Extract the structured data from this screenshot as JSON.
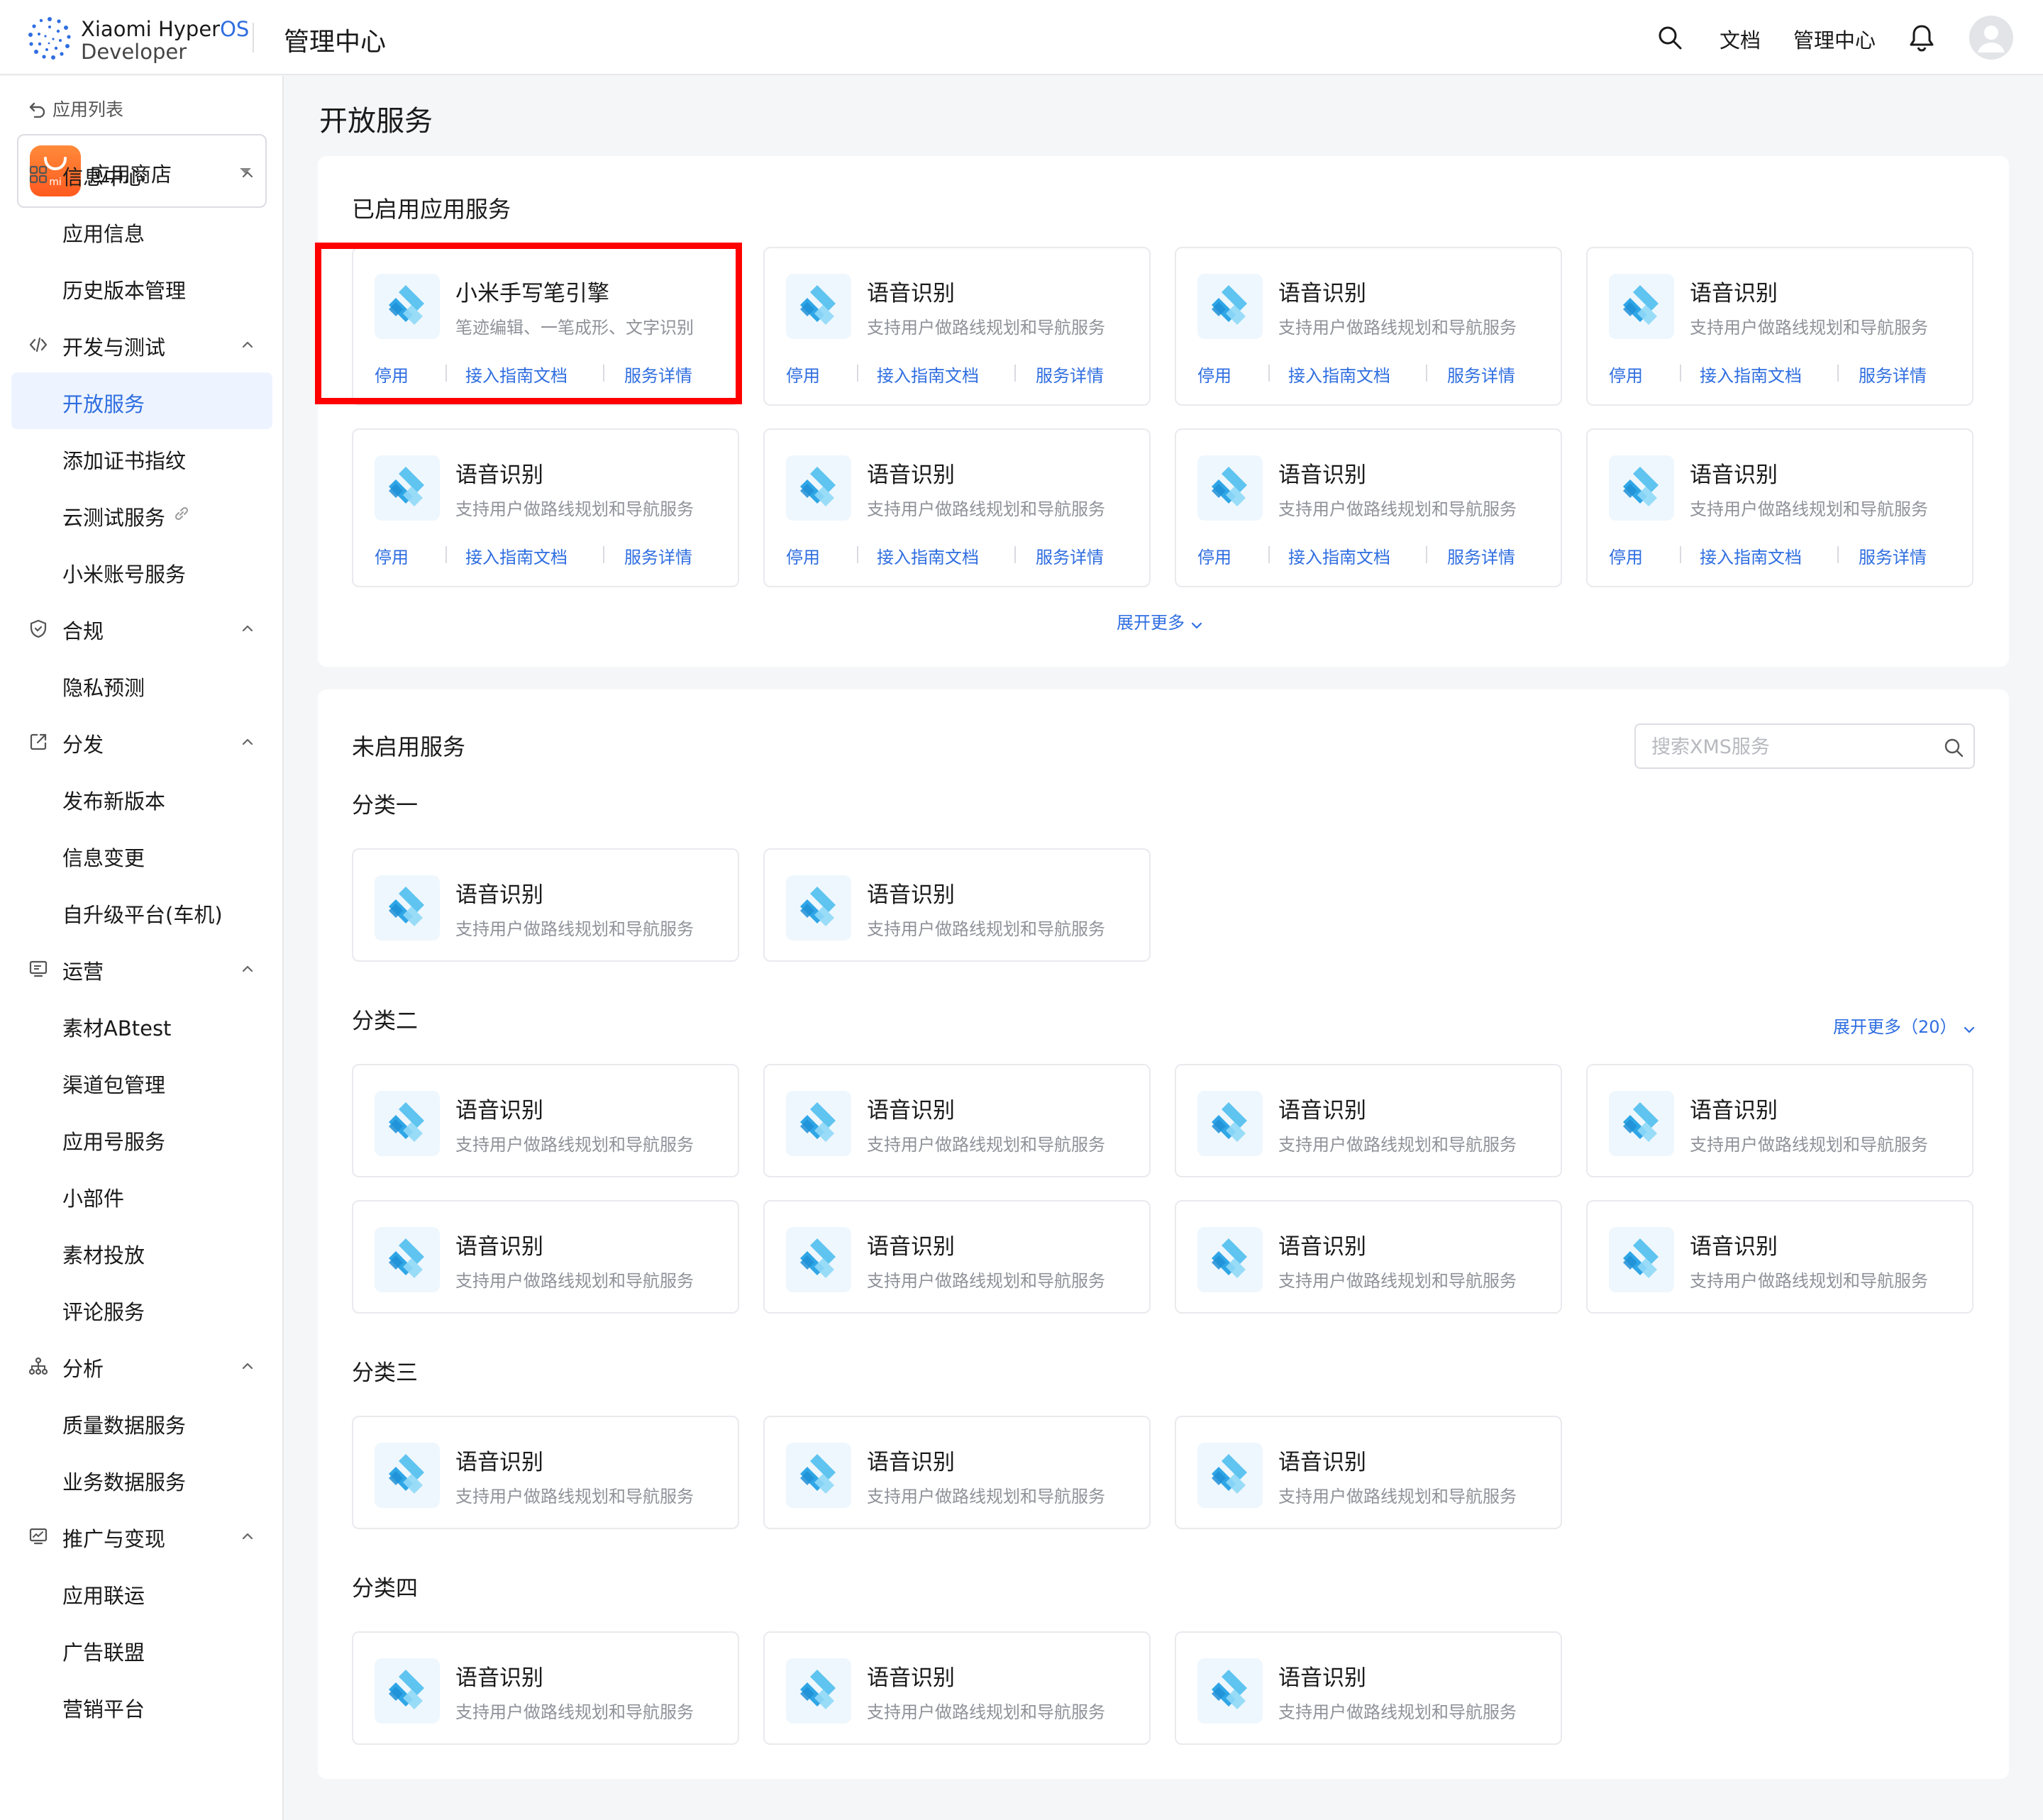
{
  "header": {
    "brand_line1": "Xiaomi Hyper",
    "brand_os": "OS",
    "brand_line2": "Developer",
    "section": "管理中心",
    "nav_docs": "文档",
    "nav_admin": "管理中心"
  },
  "sidebar": {
    "back_label": "应用列表",
    "app_name": "应用商店",
    "app_icon_text": "mi",
    "items": [
      {
        "type": "group",
        "label": "信息中心",
        "icon": "grid-icon"
      },
      {
        "type": "sub",
        "label": "应用信息"
      },
      {
        "type": "sub",
        "label": "历史版本管理"
      },
      {
        "type": "group",
        "label": "开发与测试",
        "icon": "code-icon"
      },
      {
        "type": "sub",
        "label": "开放服务",
        "active": true
      },
      {
        "type": "sub",
        "label": "添加证书指纹"
      },
      {
        "type": "sub",
        "label": "云测试服务",
        "link": true
      },
      {
        "type": "sub",
        "label": "小米账号服务"
      },
      {
        "type": "group",
        "label": "合规",
        "icon": "shield-icon"
      },
      {
        "type": "sub",
        "label": "隐私预测"
      },
      {
        "type": "group",
        "label": "分发",
        "icon": "share-icon"
      },
      {
        "type": "sub",
        "label": "发布新版本"
      },
      {
        "type": "sub",
        "label": "信息变更"
      },
      {
        "type": "sub",
        "label": "自升级平台(车机)"
      },
      {
        "type": "group",
        "label": "运营",
        "icon": "monitor-icon"
      },
      {
        "type": "sub",
        "label": "素材ABtest"
      },
      {
        "type": "sub",
        "label": "渠道包管理"
      },
      {
        "type": "sub",
        "label": "应用号服务"
      },
      {
        "type": "sub",
        "label": "小部件"
      },
      {
        "type": "sub",
        "label": "素材投放"
      },
      {
        "type": "sub",
        "label": "评论服务"
      },
      {
        "type": "group",
        "label": "分析",
        "icon": "hierarchy-icon"
      },
      {
        "type": "sub",
        "label": "质量数据服务"
      },
      {
        "type": "sub",
        "label": "业务数据服务"
      },
      {
        "type": "group",
        "label": "推广与变现",
        "icon": "chart-monitor-icon"
      },
      {
        "type": "sub",
        "label": "应用联运"
      },
      {
        "type": "sub",
        "label": "广告联盟"
      },
      {
        "type": "sub",
        "label": "营销平台"
      }
    ]
  },
  "main": {
    "page_title": "开放服务",
    "enabled": {
      "title": "已启用应用服务",
      "actions": {
        "disable": "停用",
        "guide": "接入指南文档",
        "detail": "服务详情"
      },
      "cards": [
        {
          "title": "小米手写笔引擎",
          "desc": "笔迹编辑、一笔成形、文字识别"
        },
        {
          "title": "语音识别",
          "desc": "支持用户做路线规划和导航服务"
        },
        {
          "title": "语音识别",
          "desc": "支持用户做路线规划和导航服务"
        },
        {
          "title": "语音识别",
          "desc": "支持用户做路线规划和导航服务"
        },
        {
          "title": "语音识别",
          "desc": "支持用户做路线规划和导航服务"
        },
        {
          "title": "语音识别",
          "desc": "支持用户做路线规划和导航服务"
        },
        {
          "title": "语音识别",
          "desc": "支持用户做路线规划和导航服务"
        },
        {
          "title": "语音识别",
          "desc": "支持用户做路线规划和导航服务"
        }
      ],
      "expand_label": "展开更多"
    },
    "disabled": {
      "title": "未启用服务",
      "search_placeholder": "搜索XMS服务",
      "categories": [
        {
          "name": "分类一",
          "count": 2
        },
        {
          "name": "分类二",
          "count": 8,
          "expand_label": "展开更多（20）"
        },
        {
          "name": "分类三",
          "count": 3
        },
        {
          "name": "分类四",
          "count": 3
        }
      ],
      "card_title": "语音识别",
      "card_desc": "支持用户做路线规划和导航服务"
    }
  },
  "colors": {
    "accent": "#2f6ee0",
    "highlight": "#ff0000",
    "app_icon": "#ff6a2a"
  }
}
